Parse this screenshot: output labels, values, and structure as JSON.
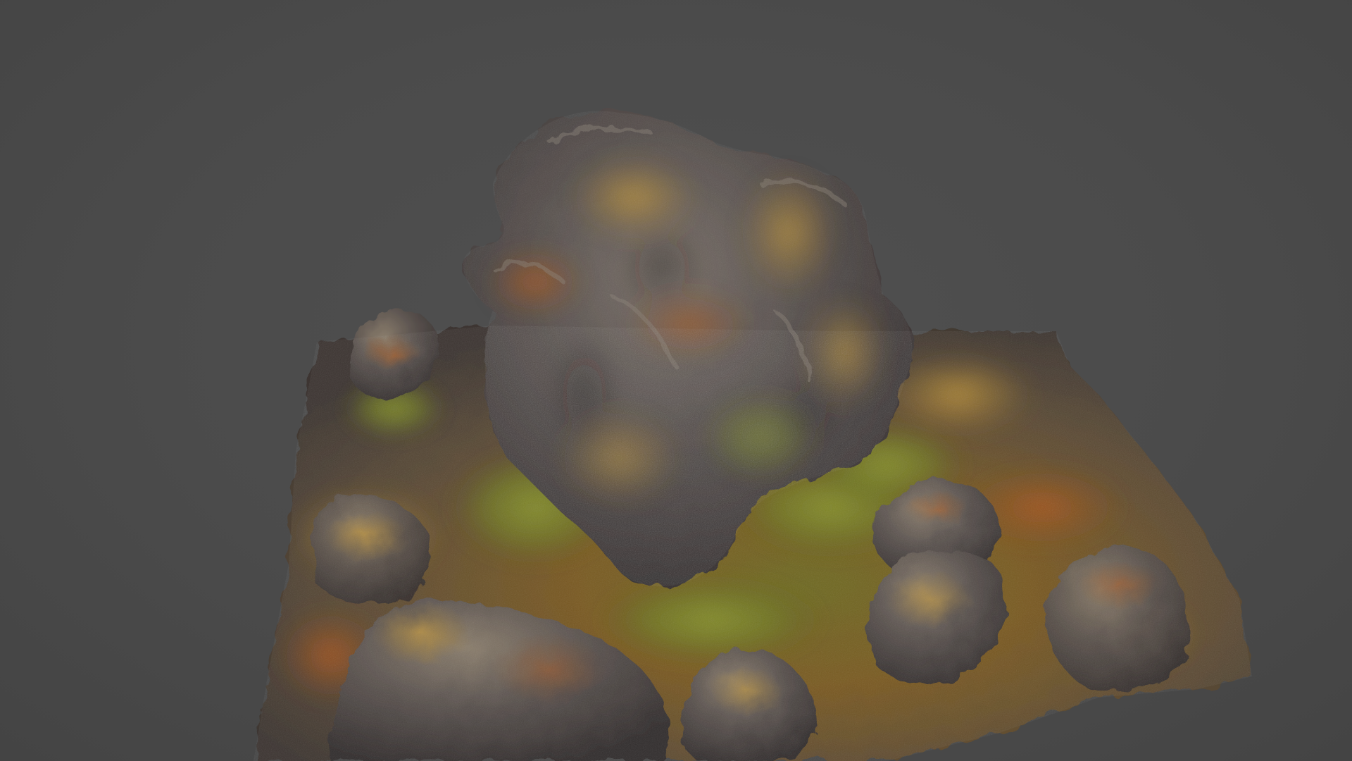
{
  "scene": {
    "background_color": "#4a4a4a",
    "subject": "rock-outcrop-3d-model",
    "palette": {
      "rock_dark": "#3a3637",
      "rock_mid": "#5a5350",
      "rock_light": "#7a7068",
      "rust": "#a0521e",
      "ochre": "#b88a2e",
      "moss": "#6f7a22",
      "moss_light": "#8a9430",
      "speckle": "#d8cfc0"
    }
  }
}
